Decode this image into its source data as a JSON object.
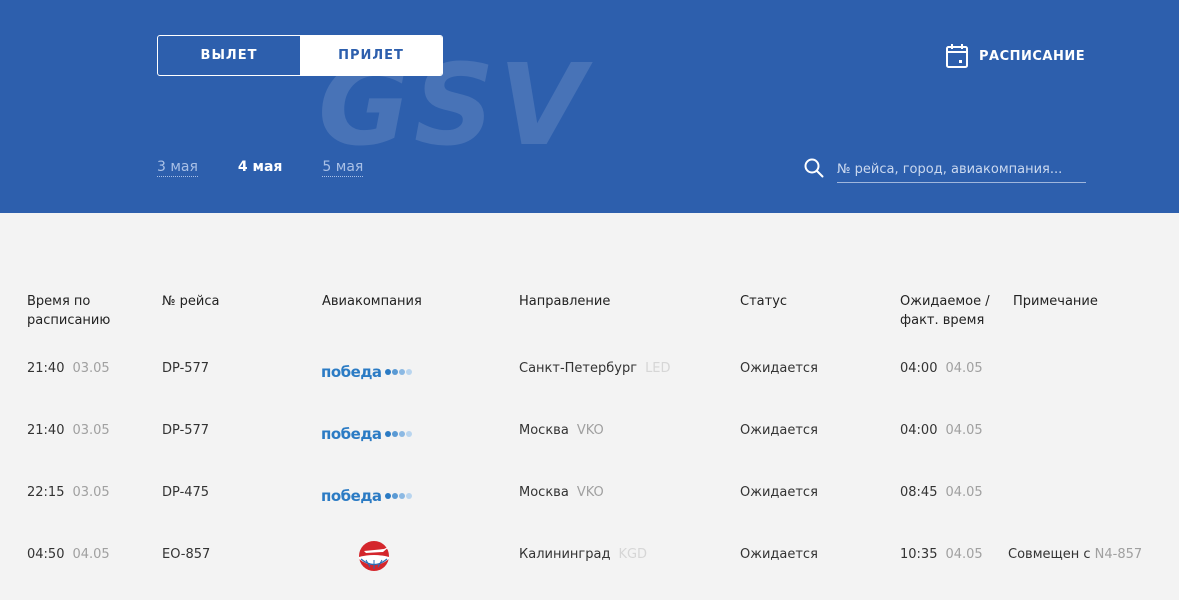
{
  "header": {
    "tabs": {
      "departure": "ВЫЛЕТ",
      "arrival": "ПРИЛЕТ"
    },
    "watermark": "GSV",
    "schedule_label": "РАСПИСАНИЕ",
    "dates": [
      "3 мая",
      "4 мая",
      "5 мая"
    ],
    "active_date": "4 мая",
    "search_placeholder": "№ рейса, город, авиакомпания..."
  },
  "table": {
    "columns": {
      "sched_time_1": "Время по",
      "sched_time_2": "расписанию",
      "flight": "№ рейса",
      "airline": "Авиакомпания",
      "direction": "Направление",
      "status": "Статус",
      "expected_1": "Ожидаемое /",
      "expected_2": "факт. время",
      "note": "Примечание"
    },
    "rows": [
      {
        "time": "21:40",
        "date": "03.05",
        "flight": "DP-577",
        "airline_logo": "победа",
        "city": "Санкт-Петербург",
        "code": "LED",
        "status": "Ожидается",
        "exp_time": "04:00",
        "exp_date": "04.05",
        "note": ""
      },
      {
        "time": "21:40",
        "date": "03.05",
        "flight": "DP-577",
        "airline_logo": "победа",
        "city": "Москва",
        "code": "VKO",
        "status": "Ожидается",
        "exp_time": "04:00",
        "exp_date": "04.05",
        "note": ""
      },
      {
        "time": "22:15",
        "date": "03.05",
        "flight": "DP-475",
        "airline_logo": "победа",
        "city": "Москва",
        "code": "VKO",
        "status": "Ожидается",
        "exp_time": "08:45",
        "exp_date": "04.05",
        "note": ""
      },
      {
        "time": "04:50",
        "date": "04.05",
        "flight": "EO-857",
        "airline_logo": "ural-airlines-icon",
        "city": "Калининград",
        "code": "KGD",
        "status": "Ожидается",
        "exp_time": "10:35",
        "exp_date": "04.05",
        "note": "Совмещен с",
        "note_code": "N4-857"
      }
    ]
  },
  "colors": {
    "header_bg": "#2d5fad",
    "pobeda": "#2b7bc4",
    "background": "#f3f3f3"
  }
}
